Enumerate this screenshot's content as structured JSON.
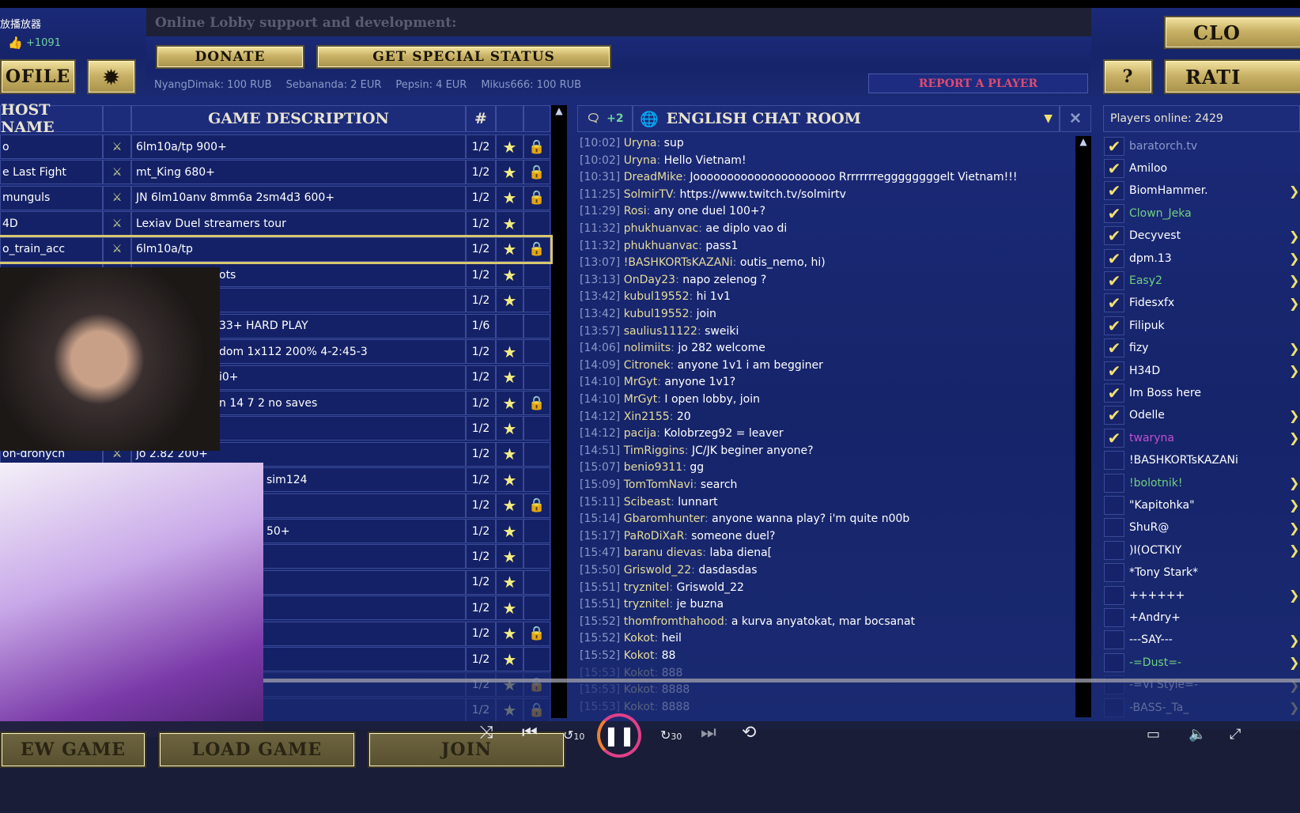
{
  "top": {
    "app_label": "放播放器",
    "likes": "+1091",
    "support_title": "Online Lobby support and development:",
    "donate": "DONATE",
    "special_status": "GET SPECIAL STATUS",
    "donors": [
      "NyangDimak: 100 RUB",
      "Sebananda: 2 EUR",
      "Pepsin: 4 EUR",
      "Mikus666: 100 RUB"
    ],
    "report": "REPORT A PLAYER",
    "profile": "OFILE",
    "help": "?",
    "rating": "RATI",
    "close": "CLO"
  },
  "games": {
    "headers": {
      "host": "HOST NAME",
      "desc": "GAME DESCRIPTION",
      "num": "#"
    },
    "rows": [
      {
        "host": "o",
        "desc": "6lm10a/tp 900+",
        "num": "1/2",
        "star": true,
        "lock": true
      },
      {
        "host": "e Last Fight",
        "desc": "mt_King 680+",
        "num": "1/2",
        "star": true,
        "lock": true
      },
      {
        "host": "munguls",
        "desc": "JN 6lm10anv 8mm6a 2sm4d3 600+",
        "num": "1/2",
        "star": true,
        "lock": true
      },
      {
        "host": "4D",
        "desc": "Lexiav Duel streamers tour",
        "num": "1/2",
        "star": true,
        "lock": false
      },
      {
        "host": "o_train_acc",
        "desc": "6lm10a/tp",
        "num": "1/2",
        "star": true,
        "lock": true,
        "selected": true
      },
      {
        "host": "",
        "desc": "ots",
        "num": "1/2",
        "star": true,
        "lock": false,
        "partial": true
      },
      {
        "host": "",
        "desc": "",
        "num": "1/2",
        "star": true,
        "lock": false
      },
      {
        "host": "",
        "desc": "33+ HARD PLAY",
        "num": "1/6",
        "star": false,
        "lock": false,
        "partial": true
      },
      {
        "host": "",
        "desc": "dom 1x112 200% 4-2:45-3",
        "num": "1/2",
        "star": true,
        "lock": false,
        "partial": true
      },
      {
        "host": "",
        "desc": "i0+",
        "num": "1/2",
        "star": true,
        "lock": false,
        "partial": true
      },
      {
        "host": "",
        "desc": "n 14 7 2 no saves",
        "num": "1/2",
        "star": true,
        "lock": true,
        "partial": true
      },
      {
        "host": "",
        "desc": "",
        "num": "1/2",
        "star": true,
        "lock": false
      },
      {
        "host": "on-dronych",
        "desc": "jo 2.82 200+",
        "num": "1/2",
        "star": true,
        "lock": false
      },
      {
        "host": "",
        "desc": "sim124",
        "num": "1/2",
        "star": true,
        "lock": false,
        "partial2": true
      },
      {
        "host": "",
        "desc": "",
        "num": "1/2",
        "star": true,
        "lock": true
      },
      {
        "host": "",
        "desc": "50+",
        "num": "1/2",
        "star": true,
        "lock": false,
        "partial2": true
      },
      {
        "host": "",
        "desc": "",
        "num": "1/2",
        "star": true,
        "lock": false
      },
      {
        "host": "",
        "desc": "",
        "num": "1/2",
        "star": true,
        "lock": false
      },
      {
        "host": "",
        "desc": "",
        "num": "1/2",
        "star": true,
        "lock": false
      },
      {
        "host": "",
        "desc": "",
        "num": "1/2",
        "star": true,
        "lock": true
      },
      {
        "host": "",
        "desc": "",
        "num": "1/2",
        "star": true,
        "lock": false
      },
      {
        "host": "",
        "desc": "",
        "num": "1/2",
        "star": true,
        "lock": true,
        "dim": true
      },
      {
        "host": "",
        "desc": "",
        "num": "1/2",
        "star": true,
        "lock": true,
        "dim": true
      }
    ]
  },
  "chat": {
    "unread": "+2",
    "title": "ENGLISH CHAT ROOM",
    "messages": [
      [
        "[10:02]",
        "Uryna",
        "sup"
      ],
      [
        "[10:02]",
        "Uryna",
        "Hello Vietnam!"
      ],
      [
        "[10:31]",
        "DreadMike",
        "Jooooooooooooooooooooo Rrrrrrrreggggggggelt Vietnam!!!"
      ],
      [
        "[11:25]",
        "SolmirTV",
        "https://www.twitch.tv/solmirtv"
      ],
      [
        "[11:29]",
        "Rosi",
        "any one duel 100+?"
      ],
      [
        "[11:32]",
        "phukhuanvac",
        "ae diplo vao di"
      ],
      [
        "[11:32]",
        "phukhuanvac",
        "pass1"
      ],
      [
        "[13:07]",
        "!BASHKORTsKAZANi",
        "outis_nemo, hi)"
      ],
      [
        "[13:13]",
        "OnDay23",
        "napo zelenog ?"
      ],
      [
        "[13:42]",
        "kubul19552",
        "hi 1v1"
      ],
      [
        "[13:42]",
        "kubul19552",
        "join"
      ],
      [
        "[13:57]",
        "saulius11122",
        "sweiki"
      ],
      [
        "[14:06]",
        "nolimiits",
        "jo 282 welcome"
      ],
      [
        "[14:09]",
        "Citronek",
        "anyone 1v1 i am begginer"
      ],
      [
        "[14:10]",
        "MrGyt",
        "anyone 1v1?"
      ],
      [
        "[14:10]",
        "MrGyt",
        "I open lobby, join"
      ],
      [
        "[14:12]",
        "Xin2155",
        "20"
      ],
      [
        "[14:12]",
        "pacija",
        "Kolobrzeg92 = leaver"
      ],
      [
        "[14:51]",
        "TimRiggins",
        "JC/JK beginer anyone?"
      ],
      [
        "[15:07]",
        "benio9311",
        "gg"
      ],
      [
        "[15:09]",
        "TomTomNavi",
        "search"
      ],
      [
        "[15:11]",
        "Scibeast",
        "lunnart"
      ],
      [
        "[15:14]",
        "Gbaromhunter",
        "anyone wanna play? i'm quite n00b"
      ],
      [
        "[15:17]",
        "PaRoDiXaR",
        "someone duel?"
      ],
      [
        "[15:47]",
        "baranu dievas",
        "laba diena["
      ],
      [
        "[15:50]",
        "Griswold_22",
        "dasdasdas"
      ],
      [
        "[15:51]",
        "tryznitel",
        "Griswold_22"
      ],
      [
        "[15:51]",
        "tryznitel",
        "je buzna"
      ],
      [
        "[15:52]",
        "thomfromthahood",
        "a kurva anyatokat, mar bocsanat"
      ],
      [
        "[15:52]",
        "Kokot",
        "heil"
      ],
      [
        "[15:52]",
        "Kokot",
        "88"
      ],
      [
        "[15:53]",
        "Kokot",
        "888"
      ],
      [
        "[15:53]",
        "Kokot",
        "8888"
      ],
      [
        "[15:53]",
        "Kokot",
        "8888"
      ]
    ]
  },
  "players": {
    "online": "Players online: 2429",
    "list": [
      {
        "name": "baratorch.tv",
        "checked": true,
        "color": "#8a98c8",
        "arrow": false
      },
      {
        "name": "Amiloo",
        "checked": true,
        "arrow": false
      },
      {
        "name": "BiomHammer.",
        "checked": true,
        "arrow": true
      },
      {
        "name": "Clown_Jeka",
        "checked": true,
        "color": "#6fd080",
        "arrow": false
      },
      {
        "name": "Decyvest",
        "checked": true,
        "arrow": true
      },
      {
        "name": "dpm.13",
        "checked": true,
        "arrow": true
      },
      {
        "name": "Easy2",
        "checked": true,
        "color": "#6fd080",
        "arrow": true
      },
      {
        "name": "Fidesxfx",
        "checked": true,
        "arrow": true
      },
      {
        "name": "Filipuk",
        "checked": true,
        "arrow": false
      },
      {
        "name": "fizy",
        "checked": true,
        "arrow": true
      },
      {
        "name": "H34D",
        "checked": true,
        "arrow": true
      },
      {
        "name": "Im Boss here",
        "checked": true,
        "arrow": false
      },
      {
        "name": "Odelle",
        "checked": true,
        "arrow": true
      },
      {
        "name": "twaryna",
        "checked": true,
        "color": "#c050d0",
        "arrow": true
      },
      {
        "name": "!BASHKORTsKAZANi",
        "checked": false,
        "arrow": false
      },
      {
        "name": "!bolotnik!",
        "checked": false,
        "color": "#6fd080",
        "arrow": true
      },
      {
        "name": "\"Kapitohka\"",
        "checked": false,
        "arrow": true
      },
      {
        "name": "ShuR@",
        "checked": false,
        "arrow": true
      },
      {
        "name": ")I(OCTKIY",
        "checked": false,
        "arrow": true
      },
      {
        "name": "*Tony Stark*",
        "checked": false,
        "arrow": false
      },
      {
        "name": "++++++",
        "checked": false,
        "arrow": true
      },
      {
        "name": "+Andry+",
        "checked": false,
        "arrow": false
      },
      {
        "name": "---SAY---",
        "checked": false,
        "arrow": true
      },
      {
        "name": "-=Dust=-",
        "checked": false,
        "color": "#6fd080",
        "arrow": true
      },
      {
        "name": "-=VI Style=-",
        "checked": false,
        "arrow": true,
        "dim": true
      },
      {
        "name": "-BASS-_Ta_",
        "checked": false,
        "arrow": true,
        "dim": true
      }
    ]
  },
  "bottom": {
    "new_game": "EW GAME",
    "load_game": "LOAD GAME",
    "join": "JOIN"
  },
  "player": {
    "rewind": "10",
    "forward": "30",
    "accent": "#e0408a"
  }
}
